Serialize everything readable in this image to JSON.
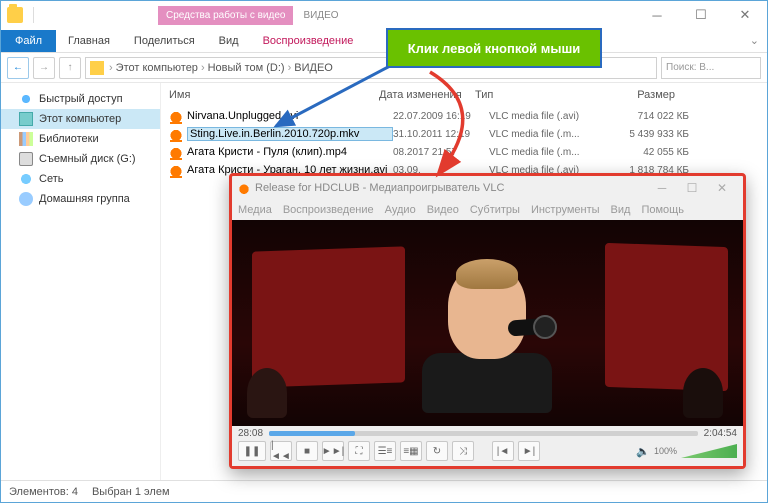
{
  "titlebar": {
    "tool_tab": "Средства работы с видео",
    "title": "ВИДЕО"
  },
  "callout": "Клик левой кнопкой мыши",
  "ribbon": {
    "file": "Файл",
    "tabs": [
      "Главная",
      "Поделиться",
      "Вид"
    ],
    "play": "Воспроизведение"
  },
  "address": {
    "crumbs": [
      "Этот компьютер",
      "Новый том (D:)",
      "ВИДЕО"
    ],
    "arrow": "›",
    "search": "Поиск: В..."
  },
  "nav": [
    {
      "label": "Быстрый доступ",
      "icon": "star"
    },
    {
      "label": "Этот компьютер",
      "icon": "pc",
      "sel": true
    },
    {
      "label": "Библиотеки",
      "icon": "lib"
    },
    {
      "label": "Съемный диск (G:)",
      "icon": "drive"
    },
    {
      "label": "Сеть",
      "icon": "net"
    },
    {
      "label": "Домашняя группа",
      "icon": "home"
    }
  ],
  "cols": {
    "name": "Имя",
    "date": "Дата изменения",
    "type": "Тип",
    "size": "Размер"
  },
  "files": [
    {
      "name": "Nirvana.Unplugged.avi",
      "date": "22.07.2009 16:19",
      "type": "VLC media file (.avi)",
      "size": "714 022 КБ"
    },
    {
      "name": "Sting.Live.in.Berlin.2010.720p.mkv",
      "date": "31.10.2011 12:19",
      "type": "VLC media file (.m...",
      "size": "5 439 933 КБ",
      "sel": true
    },
    {
      "name": "Агата Кристи - Пуля (клип).mp4",
      "date": "08.2017 21:57",
      "type": "VLC media file (.m...",
      "size": "42 055 КБ"
    },
    {
      "name": "Агата Кристи - Ураган. 10 лет жизни.avi",
      "date": "03.09.",
      "type": "VLC media file (.avi)",
      "size": "1 818 784 КБ"
    }
  ],
  "status": {
    "count": "Элементов: 4",
    "sel": "Выбран 1 элем"
  },
  "vlc": {
    "title": "Release for HDCLUB - Медиапроигрыватель VLC",
    "menu": [
      "Медиа",
      "Воспроизведение",
      "Аудио",
      "Видео",
      "Субтитры",
      "Инструменты",
      "Вид",
      "Помощь"
    ],
    "time": "28:08",
    "dur": "2:04:54",
    "vol": "100%"
  }
}
